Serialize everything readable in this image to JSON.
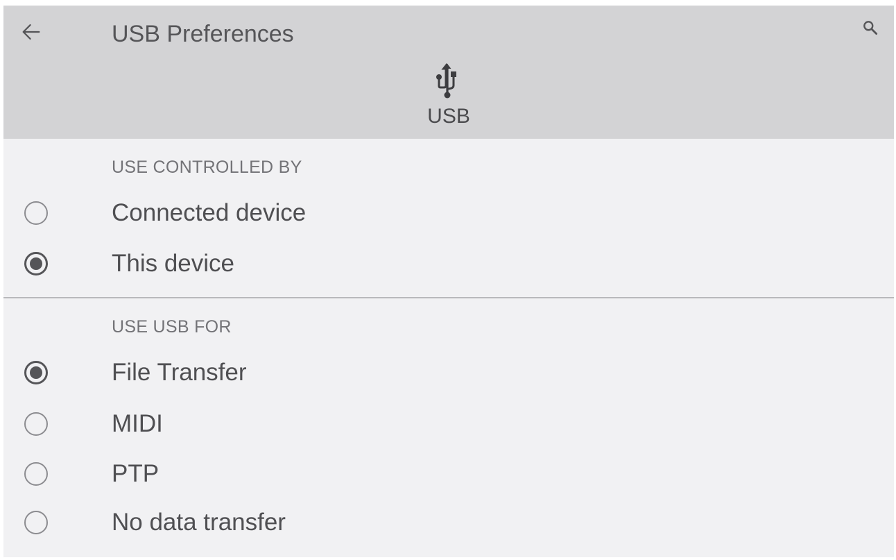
{
  "app_bar": {
    "title": "USB Preferences",
    "back_icon": "arrow-left-icon",
    "search_icon": "search-icon",
    "header_icon": "usb-icon",
    "header_label": "USB"
  },
  "sections": [
    {
      "title": "USE CONTROLLED BY",
      "options": [
        {
          "label": "Connected device",
          "selected": false
        },
        {
          "label": "This device",
          "selected": true
        }
      ]
    },
    {
      "title": "USE USB FOR",
      "options": [
        {
          "label": "File Transfer",
          "selected": true
        },
        {
          "label": "MIDI",
          "selected": false
        },
        {
          "label": "PTP",
          "selected": false
        },
        {
          "label": "No data transfer",
          "selected": false
        }
      ]
    }
  ],
  "colors": {
    "app_bar_bg": "#d3d3d5",
    "content_bg": "#f1f1f3",
    "text": "#4f4f52",
    "section_text": "#737377"
  }
}
